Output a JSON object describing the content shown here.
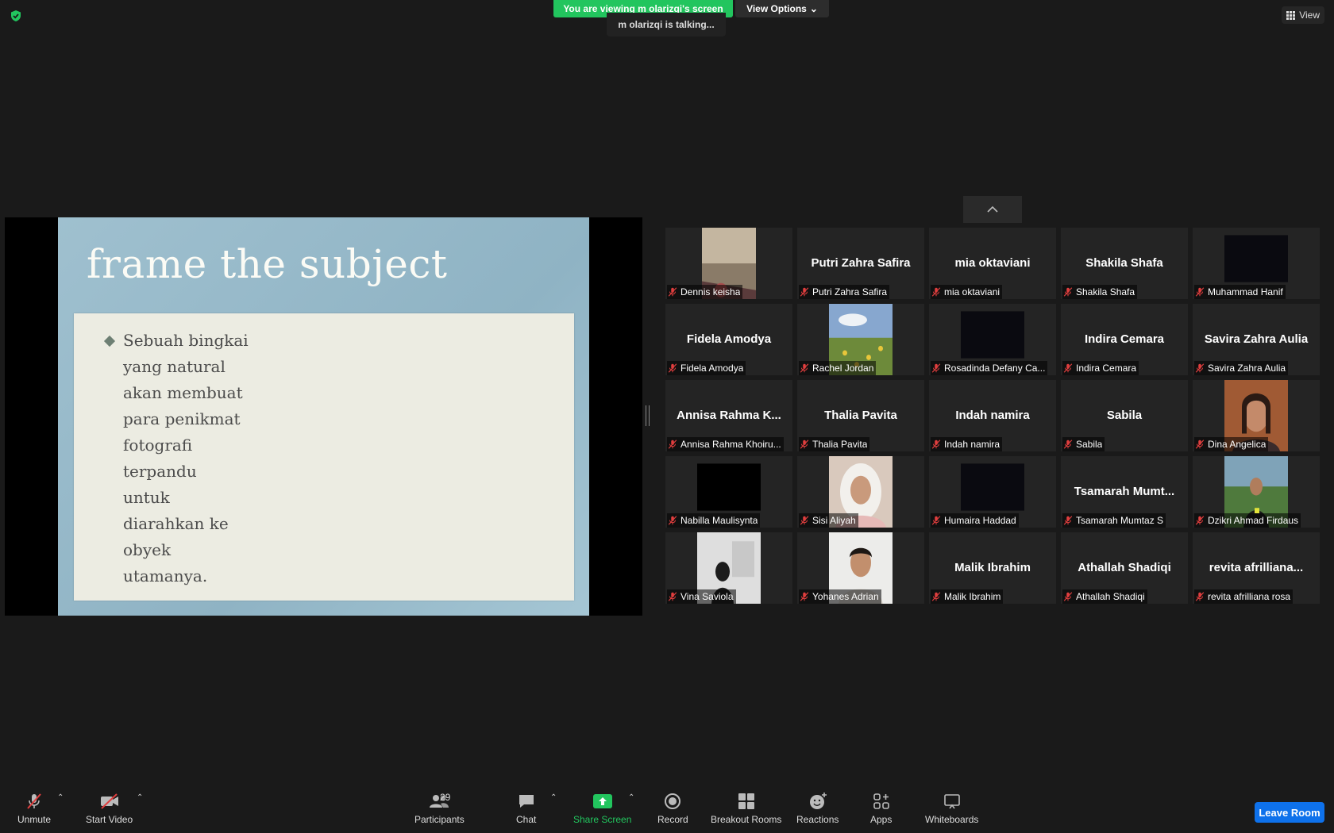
{
  "banner": {
    "text": "You are viewing m olarizqi's screen",
    "view_options": "View Options"
  },
  "talking": "m olarizqi is talking...",
  "view_button": "View",
  "slide": {
    "title": "frame the subject",
    "lines": [
      "Sebuah bingkai",
      "yang natural",
      "akan membuat",
      "para penikmat",
      "fotografi",
      "terpandu",
      "untuk",
      "diarahkan ke",
      "obyek",
      "utamanya."
    ]
  },
  "participants": [
    {
      "name": "Dennis keisha",
      "display": "",
      "video": "photo-room"
    },
    {
      "name": "Putri Zahra Safira",
      "display": "Putri Zahra Safira",
      "video": ""
    },
    {
      "name": "mia oktaviani",
      "display": "mia oktaviani",
      "video": ""
    },
    {
      "name": "Shakila Shafa",
      "display": "Shakila Shafa",
      "video": ""
    },
    {
      "name": "Muhammad Hanif",
      "display": "",
      "video": "dark"
    },
    {
      "name": "Fidela Amodya",
      "display": "Fidela Amodya",
      "video": ""
    },
    {
      "name": "Rachel Jordan",
      "display": "",
      "video": "photo-field"
    },
    {
      "name": "Rosadinda Defany Ca...",
      "display": "",
      "video": "dark"
    },
    {
      "name": "Indira Cemara",
      "display": "Indira Cemara",
      "video": ""
    },
    {
      "name": "Savira Zahra Aulia",
      "display": "Savira Zahra Aulia",
      "video": ""
    },
    {
      "name": "Annisa Rahma Khoiru...",
      "display": "Annisa Rahma K...",
      "video": ""
    },
    {
      "name": "Thalia Pavita",
      "display": "Thalia Pavita",
      "video": ""
    },
    {
      "name": "Indah namira",
      "display": "Indah namira",
      "video": ""
    },
    {
      "name": "Sabila",
      "display": "Sabila",
      "video": ""
    },
    {
      "name": "Dina Angelica",
      "display": "",
      "video": "photo-person-orange"
    },
    {
      "name": "Nabilla Maulisynta",
      "display": "",
      "video": "black"
    },
    {
      "name": "Sisi Aliyah",
      "display": "",
      "video": "photo-person-hijab"
    },
    {
      "name": "Humaira Haddad",
      "display": "",
      "video": "dark"
    },
    {
      "name": "Tsamarah Mumtaz S",
      "display": "Tsamarah Mumt...",
      "video": ""
    },
    {
      "name": "Dzikri Ahmad Firdaus",
      "display": "",
      "video": "photo-person-green"
    },
    {
      "name": "Vina Saviola",
      "display": "",
      "video": "photo-room-light"
    },
    {
      "name": "Yohanes Adrian",
      "display": "",
      "video": "photo-person-light"
    },
    {
      "name": "Malik Ibrahim",
      "display": "Malik Ibrahim",
      "video": ""
    },
    {
      "name": "Athallah Shadiqi",
      "display": "Athallah Shadiqi",
      "video": ""
    },
    {
      "name": "revita afrilliana rosa",
      "display": "revita afrilliana...",
      "video": ""
    }
  ],
  "toolbar": {
    "unmute": "Unmute",
    "start_video": "Start Video",
    "participants": "Participants",
    "participant_count": "29",
    "chat": "Chat",
    "share_screen": "Share Screen",
    "record": "Record",
    "breakout_rooms": "Breakout Rooms",
    "reactions": "Reactions",
    "apps": "Apps",
    "whiteboards": "Whiteboards",
    "leave": "Leave Room"
  },
  "colors": {
    "banner": "#22c55e",
    "share_green": "#22c55e",
    "leave_blue": "#0e71eb",
    "mute_red": "#e03e3e"
  }
}
